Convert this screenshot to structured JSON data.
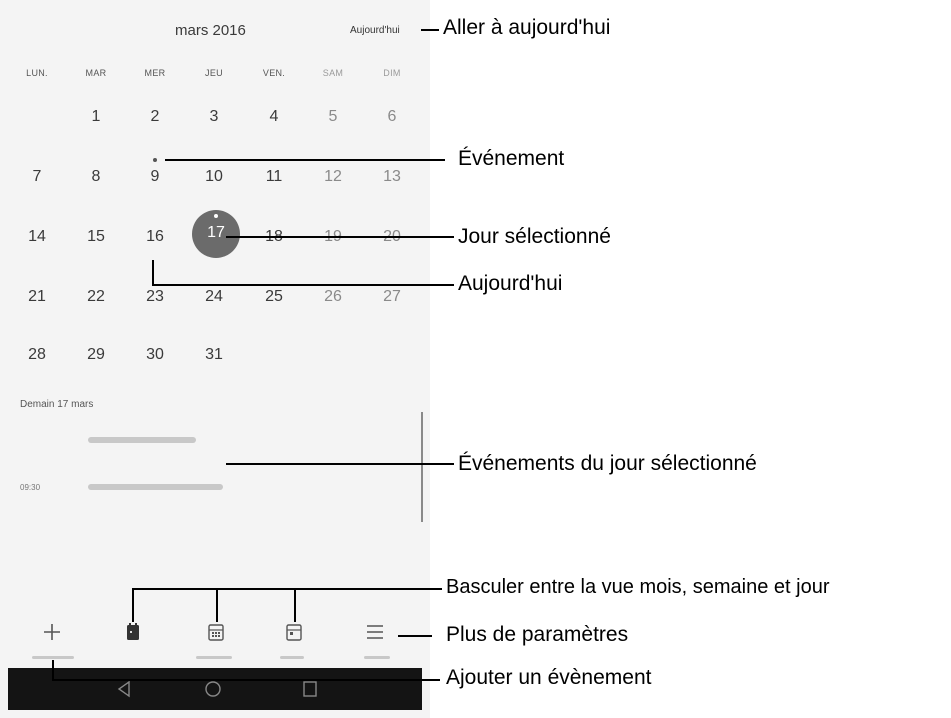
{
  "calendar": {
    "month_title": "mars 2016",
    "today_button": "Aujourd'hui",
    "weekdays": [
      "LUN.",
      "MAR",
      "MER",
      "JEU",
      "VEN.",
      "SAM",
      "DIM"
    ],
    "weeks": [
      [
        "",
        "1",
        "2",
        "3",
        "4",
        "5",
        "6"
      ],
      [
        "7",
        "8",
        "9",
        "10",
        "11",
        "12",
        "13"
      ],
      [
        "14",
        "15",
        "16",
        "17",
        "18",
        "19",
        "20"
      ],
      [
        "21",
        "22",
        "23",
        "24",
        "25",
        "26",
        "27"
      ],
      [
        "28",
        "29",
        "30",
        "31",
        "",
        "",
        ""
      ]
    ],
    "selected_day": "17",
    "today_day": "16",
    "event_days": [
      "9",
      "17"
    ]
  },
  "agenda": {
    "date_label": "Demain 17 mars",
    "time_label": "09:30"
  },
  "toolbar": {
    "icons": [
      "plus-icon",
      "month-view-icon",
      "week-view-icon",
      "day-view-icon",
      "menu-icon"
    ]
  },
  "nav": {
    "icons": [
      "back-icon",
      "home-icon",
      "recents-icon"
    ]
  },
  "callouts": {
    "today_button": "Aller à aujourd'hui",
    "event": "Événement",
    "selected_day": "Jour sélectionné",
    "today": "Aujourd'hui",
    "day_events": "Événements du jour sélectionné",
    "switch_view": "Basculer entre la vue mois, semaine et jour",
    "more_settings": "Plus de paramètres",
    "add_event": "Ajouter un évènement"
  },
  "colors": {
    "selected_circle": "#6b6b6b",
    "background": "#f4f4f4",
    "nav_bar": "#141414"
  }
}
